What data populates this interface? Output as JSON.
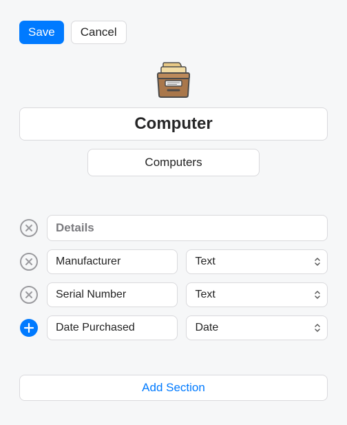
{
  "toolbar": {
    "save_label": "Save",
    "cancel_label": "Cancel"
  },
  "title_value": "Computer",
  "category_value": "Computers",
  "section": {
    "name": "Details",
    "fields": [
      {
        "label": "Manufacturer",
        "type": "Text"
      },
      {
        "label": "Serial Number",
        "type": "Text"
      },
      {
        "label": "Date Purchased",
        "type": "Date"
      }
    ]
  },
  "footer": {
    "add_section_label": "Add Section"
  },
  "icons": {
    "remove": "x-circle-icon",
    "add": "plus-circle-icon",
    "drawer": "file-drawer-icon",
    "updown": "chevron-up-down-icon"
  }
}
